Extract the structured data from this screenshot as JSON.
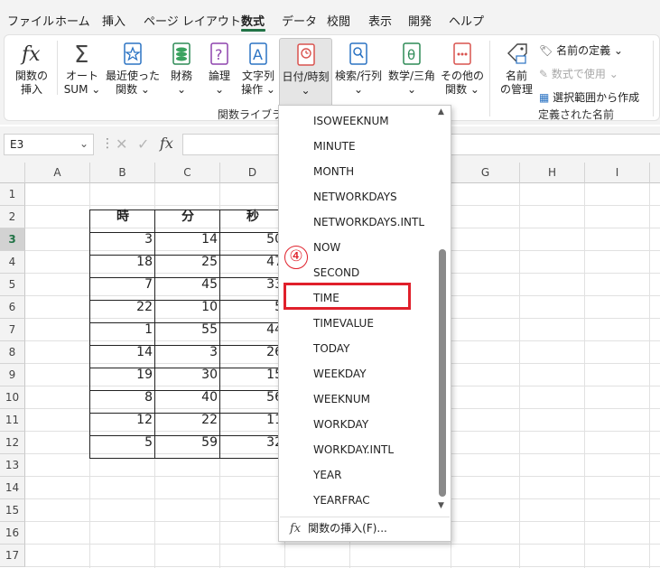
{
  "menu": {
    "tabs": [
      "ファイル",
      "ホーム",
      "挿入",
      "ページ レイアウト",
      "数式",
      "データ",
      "校閲",
      "表示",
      "開発",
      "ヘルプ"
    ],
    "active_tab": "数式"
  },
  "ribbon": {
    "insert_function": {
      "line1": "関数の",
      "line2": "挿入"
    },
    "autosum": {
      "line1": "オート",
      "line2": "SUM ⌄"
    },
    "recent": {
      "line1": "最近使った",
      "line2": "関数 ⌄"
    },
    "financial": {
      "line1": "財務",
      "line2": "⌄"
    },
    "logical": {
      "line1": "論理",
      "line2": "⌄"
    },
    "text": {
      "line1": "文字列",
      "line2": "操作 ⌄"
    },
    "datetime": {
      "line1": "日付/時刻",
      "line2": "⌄"
    },
    "lookup": {
      "line1": "検索/行列",
      "line2": "⌄"
    },
    "math": {
      "line1": "数学/三角",
      "line2": "⌄"
    },
    "more": {
      "line1": "その他の",
      "line2": "関数 ⌄"
    },
    "group_library_label": "関数ライブラリ",
    "name_manager": {
      "line1": "名前",
      "line2": "の管理"
    },
    "define_name": "名前の定義 ⌄",
    "use_in_formula": "数式で使用 ⌄",
    "create_from_selection": "選択範囲から作成",
    "group_names_label": "定義された名前"
  },
  "formula_bar": {
    "name_box": "E3",
    "fx": "fx"
  },
  "grid": {
    "columns": [
      "A",
      "B",
      "C",
      "D",
      "E",
      "F",
      "G",
      "H",
      "I"
    ],
    "rows": [
      "1",
      "2",
      "3",
      "4",
      "5",
      "6",
      "7",
      "8",
      "9",
      "10",
      "11",
      "12",
      "13",
      "14",
      "15",
      "16",
      "17"
    ],
    "selected_row": "3",
    "table_headers": [
      "時",
      "分",
      "秒"
    ],
    "table_rows": [
      [
        "3",
        "14",
        "50"
      ],
      [
        "18",
        "25",
        "47"
      ],
      [
        "7",
        "45",
        "33"
      ],
      [
        "22",
        "10",
        "5"
      ],
      [
        "1",
        "55",
        "44"
      ],
      [
        "14",
        "3",
        "26"
      ],
      [
        "19",
        "30",
        "15"
      ],
      [
        "8",
        "40",
        "56"
      ],
      [
        "12",
        "22",
        "11"
      ],
      [
        "5",
        "59",
        "32"
      ]
    ]
  },
  "dropdown": {
    "items": [
      "ISOWEEKNUM",
      "MINUTE",
      "MONTH",
      "NETWORKDAYS",
      "NETWORKDAYS.INTL",
      "NOW",
      "SECOND",
      "TIME",
      "TIMEVALUE",
      "TODAY",
      "WEEKDAY",
      "WEEKNUM",
      "WORKDAY",
      "WORKDAY.INTL",
      "YEAR",
      "YEARFRAC"
    ],
    "highlighted": "TIME",
    "insert_function": "関数の挿入(F)...",
    "fx": "fx"
  },
  "annotation": {
    "step_marker": "④"
  },
  "colors": {
    "accent": "#217346",
    "highlight": "#e0202b"
  }
}
